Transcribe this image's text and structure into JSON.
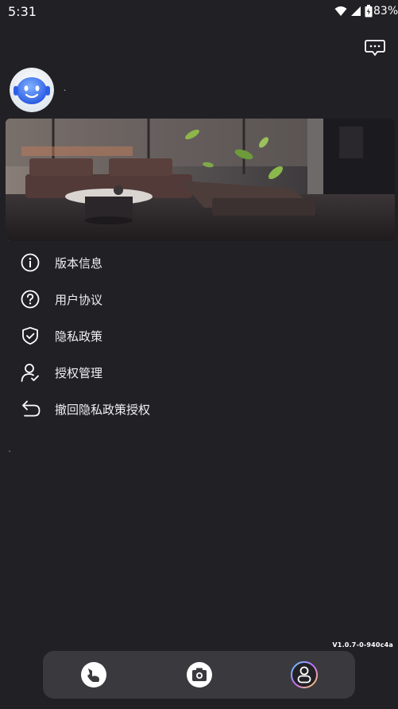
{
  "status_bar": {
    "time": "5:31",
    "battery_percent": "83%",
    "icons": [
      "wifi-icon",
      "signal-icon",
      "battery-icon"
    ]
  },
  "header": {
    "message_icon": "chat-bubble-icon"
  },
  "profile": {
    "username": "."
  },
  "banner": {
    "icon": "living-room-photo"
  },
  "menu": {
    "items": [
      {
        "label": "版本信息",
        "icon": "info-icon"
      },
      {
        "label": "用户协议",
        "icon": "question-icon"
      },
      {
        "label": "隐私政策",
        "icon": "shield-check-icon"
      },
      {
        "label": "授权管理",
        "icon": "user-check-icon"
      },
      {
        "label": "撤回隐私政策授权",
        "icon": "undo-arrow-icon"
      }
    ]
  },
  "footer": {
    "version": "V1.0.7-0-940c4a"
  },
  "bottom_nav": {
    "items": [
      {
        "icon": "tap-hand-icon"
      },
      {
        "icon": "camera-icon"
      },
      {
        "icon": "profile-icon"
      }
    ]
  },
  "colors": {
    "background": "#212025",
    "bottom_bar": "#3a3a3e",
    "text": "#f0f0f2"
  }
}
